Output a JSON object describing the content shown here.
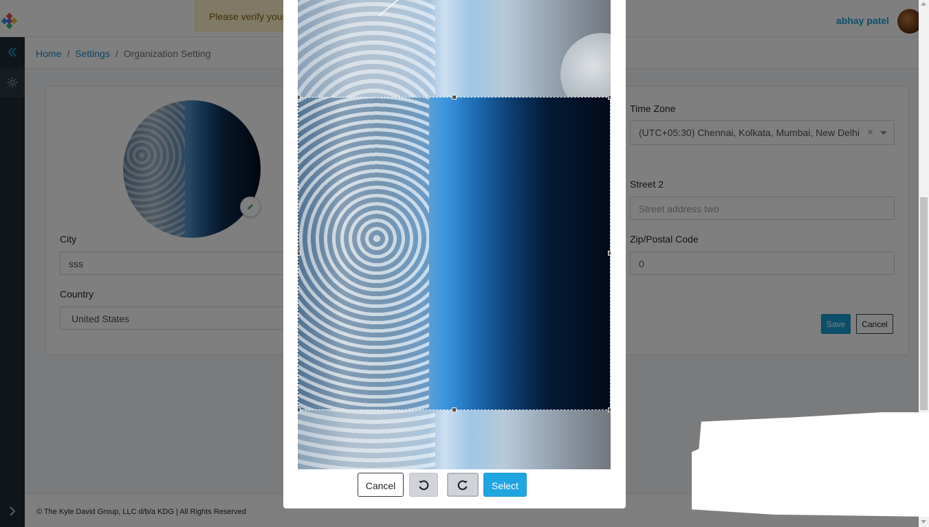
{
  "header": {
    "verify_banner": "Please verify your",
    "user_name": "abhay patel"
  },
  "breadcrumb": {
    "home": "Home",
    "settings": "Settings",
    "current": "Organization Setting",
    "separator": "/"
  },
  "form": {
    "city_label": "City",
    "city_value": "sss",
    "country_label": "Country",
    "country_value": "United States",
    "timezone_label": "Time Zone",
    "timezone_value": "(UTC+05:30) Chennai, Kolkata, Mumbai, New Delhi",
    "timezone_clear": "×",
    "street2_label": "Street 2",
    "street2_placeholder": "Street address two",
    "zip_label": "Zip/Postal Code",
    "zip_value": "0",
    "save_label": "Save",
    "cancel_label": "Cancel"
  },
  "cropper": {
    "cancel_label": "Cancel",
    "select_label": "Select",
    "rotate_left_icon": "rotate-left-icon",
    "rotate_right_icon": "rotate-right-icon"
  },
  "footer": {
    "copyright": "© The Kyle David Group, LLC d/b/a KDG | All Rights Reserved"
  },
  "colors": {
    "accent": "#1a9fd6",
    "sidebar": "#1f2a33",
    "overlay": "rgba(0,0,0,0.5)"
  }
}
